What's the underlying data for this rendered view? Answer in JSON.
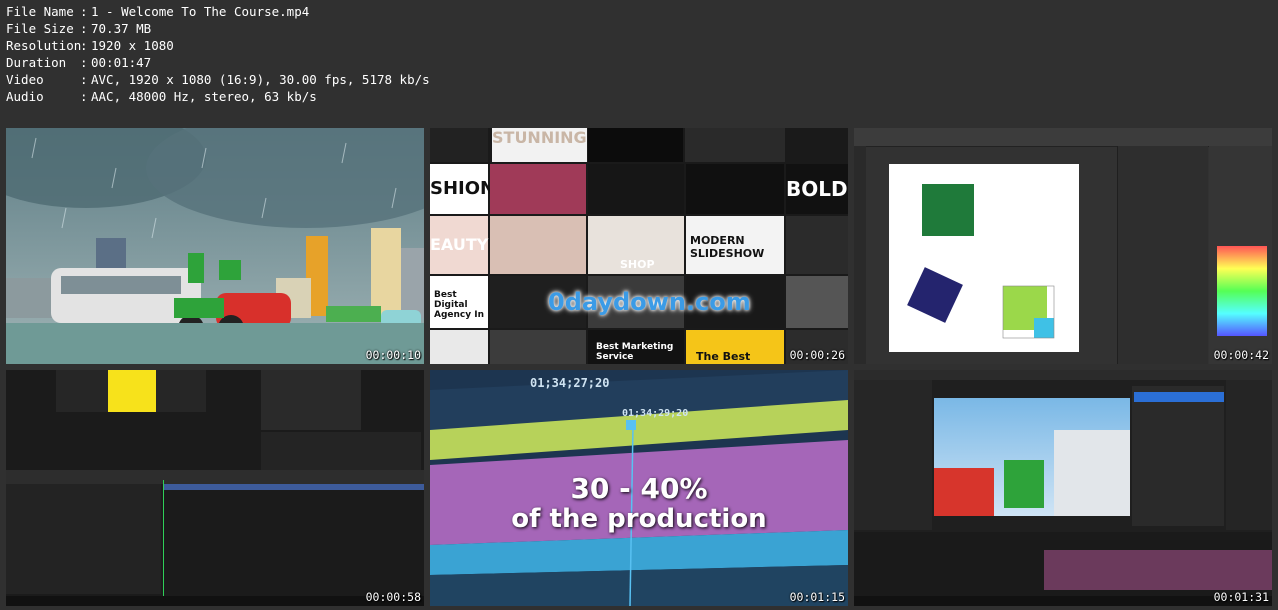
{
  "file_info": [
    {
      "key": "File Name",
      "value": "1 - Welcome To The Course.mp4"
    },
    {
      "key": "File Size",
      "value": "70.37 MB"
    },
    {
      "key": "Resolution",
      "value": "1920 x 1080"
    },
    {
      "key": "Duration",
      "value": "00:01:47"
    },
    {
      "key": "Video",
      "value": "AVC, 1920 x 1080 (16:9), 30.00 fps, 5178 kb/s"
    },
    {
      "key": "Audio",
      "value": "AAC, 48000 Hz, stereo, 63 kb/s"
    }
  ],
  "separator": ":",
  "thumbnails": [
    {
      "timestamp": "00:00:10"
    },
    {
      "timestamp": "00:00:26",
      "tiles": [
        "STUNNING",
        "BOLD",
        "SHION",
        "EAUTY",
        "MODERN SLIDESHOW",
        "SHOP",
        "Best Digital Agency In",
        "Best Marketing Service",
        "The Best"
      ],
      "watermark": "0daydown.com"
    },
    {
      "timestamp": "00:00:42"
    },
    {
      "timestamp": "00:00:58"
    },
    {
      "timestamp": "00:01:15",
      "line1": "30 - 40%",
      "line2": "of the production",
      "tc1": "01;34;27;20",
      "tc2": "01;34;29;20"
    },
    {
      "timestamp": "00:01:31"
    }
  ]
}
